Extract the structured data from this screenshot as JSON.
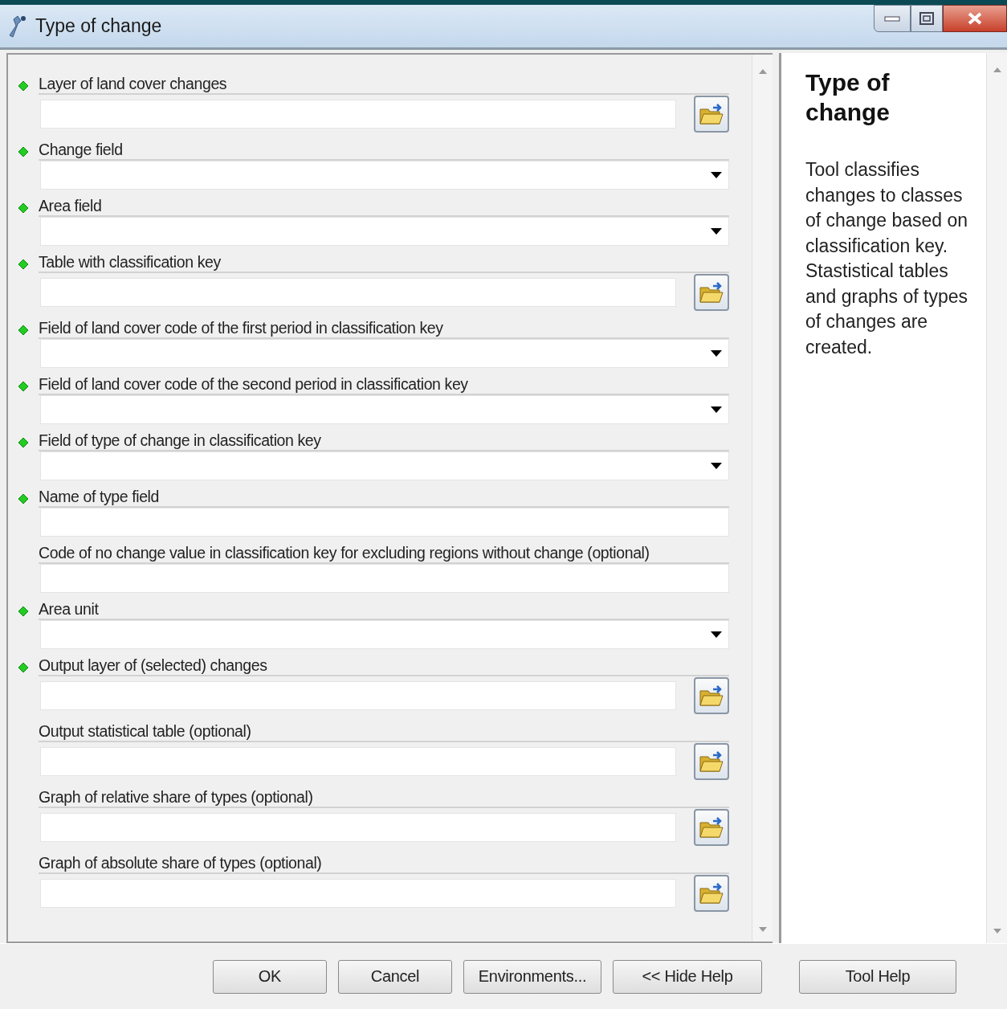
{
  "window": {
    "title": "Type of change"
  },
  "parameters": [
    {
      "label": "Layer of land cover changes",
      "kind": "file",
      "required": true
    },
    {
      "label": "Change field",
      "kind": "dropdown",
      "required": true
    },
    {
      "label": "Area field",
      "kind": "dropdown",
      "required": true
    },
    {
      "label": "Table with classification key",
      "kind": "file",
      "required": true
    },
    {
      "label": "Field of land cover code of the first period in classification key",
      "kind": "dropdown",
      "required": true
    },
    {
      "label": "Field of land cover code of the second period in classification key",
      "kind": "dropdown",
      "required": true
    },
    {
      "label": "Field of type of change in classification key",
      "kind": "dropdown",
      "required": true
    },
    {
      "label": "Name of type field",
      "kind": "text",
      "required": true
    },
    {
      "label": "Code of no change value in classification key for excluding regions without change (optional)",
      "kind": "text",
      "required": false
    },
    {
      "label": "Area unit",
      "kind": "dropdown",
      "required": true
    },
    {
      "label": "Output layer of (selected) changes",
      "kind": "file",
      "required": true
    },
    {
      "label": "Output statistical table (optional)",
      "kind": "file",
      "required": false
    },
    {
      "label": "Graph of relative share of types (optional)",
      "kind": "file",
      "required": false
    },
    {
      "label": "Graph of absolute share of types (optional)",
      "kind": "file",
      "required": false
    }
  ],
  "help": {
    "title": "Type of change",
    "text": "Tool classifies changes to classes of change based on classification key. Stastistical tables and graphs of types of changes are created."
  },
  "buttons": [
    "OK",
    "Cancel",
    "Environments...",
    "<< Hide Help",
    "Tool Help"
  ]
}
